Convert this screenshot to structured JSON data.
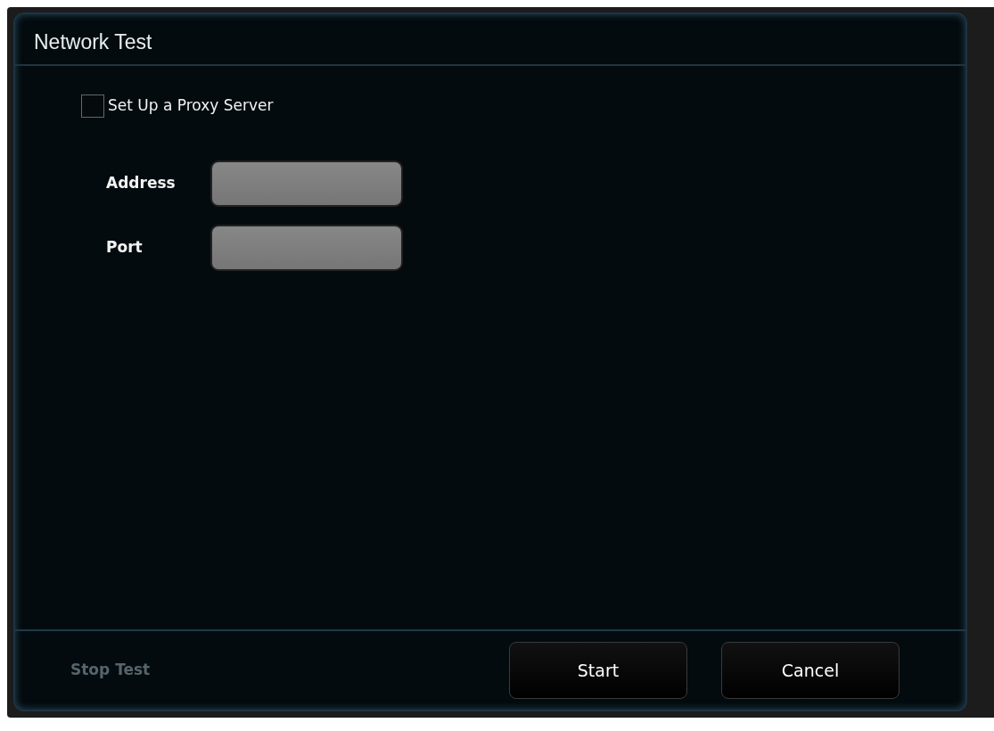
{
  "dialog": {
    "title": "Network Test"
  },
  "proxy_checkbox": {
    "label": "Set Up a Proxy Server",
    "checked": false
  },
  "fields": [
    {
      "label": "Address"
    },
    {
      "label": "Port"
    }
  ],
  "background_button": {
    "label": "Stop Test"
  },
  "buttons": [
    {
      "label": "Start"
    },
    {
      "label": "Cancel"
    }
  ]
}
